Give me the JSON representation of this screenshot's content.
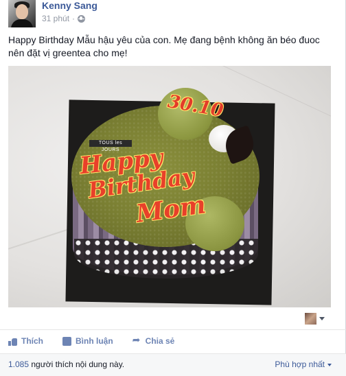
{
  "post": {
    "author": "Kenny Sang",
    "time": "31 phút",
    "text": "Happy Birthday Mẫu hậu yêu của con. Mẹ đang bệnh không ăn béo đuoc nên đặt vị greentea cho mẹ!",
    "photo": {
      "cake_tag": "TOUS les JOURS",
      "date_piping": "30.10",
      "script_line1": "Happy",
      "script_line2": "Birthday",
      "script_line3": "Mom"
    }
  },
  "actions": {
    "like_label": "Thích",
    "comment_label": "Bình luận",
    "share_label": "Chia sẻ"
  },
  "likes": {
    "count": "1.085",
    "suffix": "người thích nội dung này."
  },
  "sort": {
    "label": "Phù hợp nhất"
  },
  "icons": [
    "globe-icon",
    "like-icon",
    "comment-icon",
    "share-icon",
    "caret-icon"
  ],
  "colors": {
    "link": "#3b5998",
    "action": "#6d84b4",
    "meta": "#9197a3"
  }
}
